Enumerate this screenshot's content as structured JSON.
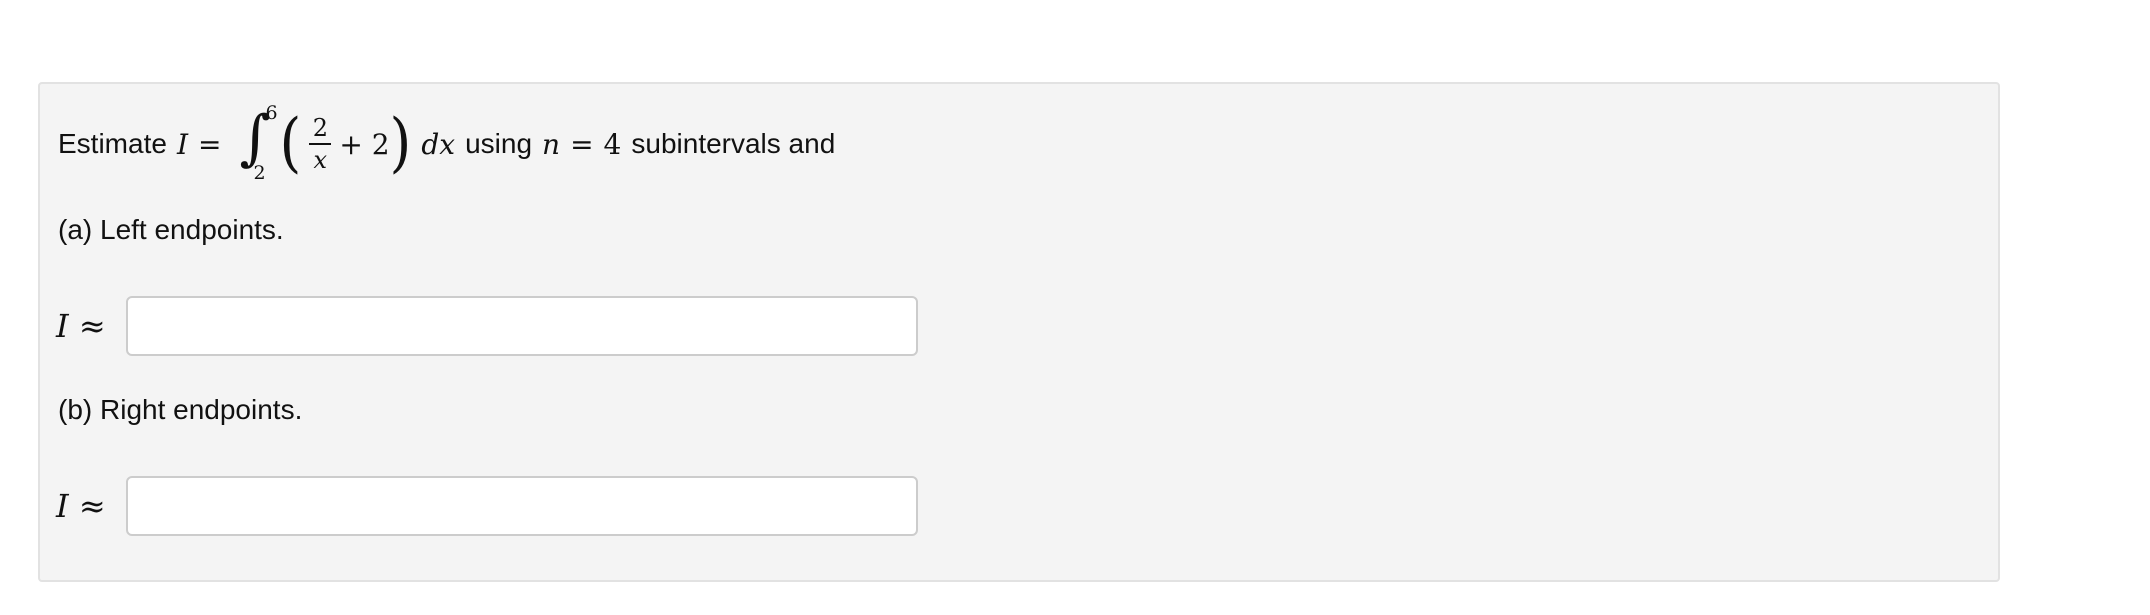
{
  "question": {
    "prefix": "Estimate",
    "var_I": "I",
    "equals": "=",
    "integral_sign": "∫",
    "upper_limit": "6",
    "lower_limit": "2",
    "open_paren": "(",
    "frac_num": "2",
    "frac_den": "x",
    "plus_term": "+ 2",
    "close_paren": ")",
    "dx": "dx",
    "mid_text": "using",
    "n_var": "n",
    "n_equals": "=",
    "n_value": "4",
    "suffix": "subintervals and"
  },
  "part_a": {
    "label": "(a) Left endpoints.",
    "approx_label": "I ≈",
    "input_value": "",
    "input_placeholder": ""
  },
  "part_b": {
    "label": "(b) Right endpoints.",
    "approx_label": "I ≈",
    "input_value": "",
    "input_placeholder": ""
  }
}
